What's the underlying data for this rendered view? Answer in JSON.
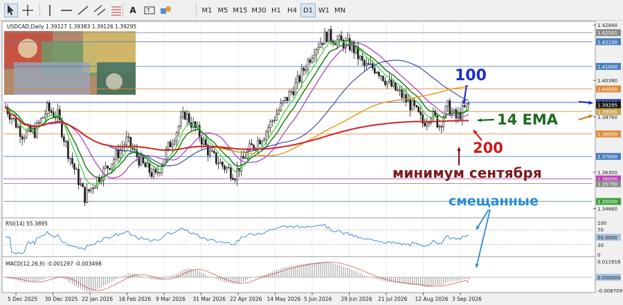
{
  "toolbar": {
    "tools": [
      {
        "name": "cursor-tool",
        "icon": "arrow-cursor-icon"
      },
      {
        "name": "crosshair-tool",
        "icon": "crosshair-icon"
      },
      {
        "name": "vertical-line-tool",
        "icon": "vertical-line-icon"
      },
      {
        "name": "horizontal-line-tool",
        "icon": "horizontal-line-icon"
      },
      {
        "name": "trend-line-tool",
        "icon": "trend-line-icon"
      },
      {
        "name": "equidistant-channel-tool",
        "icon": "channel-icon"
      },
      {
        "name": "fibonacci-tool",
        "icon": "fibonacci-icon"
      },
      {
        "name": "text-tool",
        "icon": "text-icon",
        "label": "A"
      },
      {
        "name": "text-label-tool",
        "icon": "text-label-icon"
      },
      {
        "name": "shapes-tool",
        "icon": "shapes-icon"
      }
    ],
    "timeframes": [
      "M1",
      "M5",
      "M15",
      "M30",
      "H1",
      "H4",
      "D1",
      "W1",
      "MN"
    ],
    "active_timeframe": "D1"
  },
  "chart_data": {
    "type": "candlestick",
    "symbol_header": "USDCAD,Daily  1.39127 1.39383 1.39126 1.39295",
    "x_labels": [
      "5 Dec 2025",
      "30 Dec 2025",
      "22 Jan 2026",
      "16 Feb 2026",
      "9 Mar 2026",
      "31 Mar 2026",
      "22 Apr 2026",
      "14 May 2026",
      "5 Jun 2026",
      "29 Jun 2026",
      "21 Jul 2026",
      "12 Aug 2026",
      "3 Sep 2026"
    ],
    "price_axis": {
      "ylim": [
        1.343,
        1.43
      ],
      "ticks": [
        "1.42840",
        "1.42501",
        "1.42100",
        "1.41000",
        "1.40380",
        "1.40000",
        "1.39400",
        "1.39000",
        "1.38760",
        "1.38000",
        "1.37000",
        "1.36300",
        "1.36000",
        "1.35790",
        "1.35000",
        "1.34680"
      ],
      "highlighted": [
        "1.42501",
        "1.42100",
        "1.41000",
        "1.40000",
        "1.39400",
        "1.39000",
        "1.38000",
        "1.37000",
        "1.36000",
        "1.35790",
        "1.35000"
      ]
    },
    "levels": [
      {
        "price": 1.42501,
        "color": "#8a8a8a"
      },
      {
        "price": 1.421,
        "color": "#4a7fbf"
      },
      {
        "price": 1.41,
        "color": "#4a7fbf"
      },
      {
        "price": 1.4,
        "color": "#e08a3a"
      },
      {
        "price": 1.394,
        "color": "#3a4fb8"
      },
      {
        "price": 1.39,
        "color": "#caa24a"
      },
      {
        "price": 1.38,
        "color": "#e08a3a"
      },
      {
        "price": 1.37,
        "color": "#4a7fbf"
      },
      {
        "price": 1.36,
        "color": "#c040c0"
      },
      {
        "price": 1.3579,
        "color": "#8a8a8a"
      },
      {
        "price": 1.35,
        "color": "#3aa33a"
      }
    ],
    "last_price": 1.39295,
    "series_colors": {
      "ema14": "#1f7a1f",
      "ema_fast": "#2bd62b",
      "ma_purple": "#b050c8",
      "ma_blue": "#1f2f8f",
      "ma100": "#e89a1a",
      "ma200": "#d02020",
      "bull": "#1a1a1a",
      "bear": "#1a1a1a"
    },
    "annotations": [
      {
        "text": "100",
        "color": "#1c2fc8"
      },
      {
        "text": "14 EMA",
        "color": "#1f6b1f"
      },
      {
        "text": "200",
        "color": "#d01818"
      },
      {
        "text": "минимум сентября",
        "color": "#7a1a1a"
      },
      {
        "text": "смещанные",
        "color": "#2a8ad8"
      }
    ],
    "rsi": {
      "label": "RSI(14) 55.3895",
      "value": 55.3895,
      "ticks": [
        "100",
        "70",
        "50.0000",
        "30",
        "0"
      ]
    },
    "macd": {
      "label": "MACD(12,26,9) -0.001297 -0.003498",
      "main": -0.001297,
      "signal": -0.003498,
      "ticks": [
        "0.011916",
        "0.000000",
        "-0.008709"
      ]
    }
  }
}
